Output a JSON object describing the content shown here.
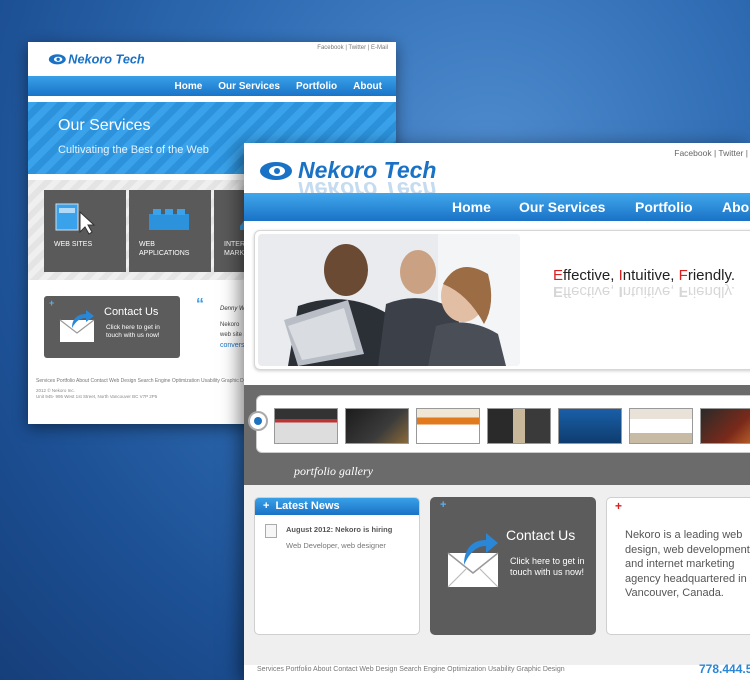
{
  "back_page": {
    "brand": "Nekoro Tech",
    "top_links": "Facebook | Twitter | E-Mail",
    "nav": [
      "Home",
      "Our Services",
      "Portfolio",
      "About"
    ],
    "hero": {
      "title": "Our Services",
      "subtitle": "Cultivating the Best of the Web"
    },
    "tiles": [
      {
        "label": "WEB SITES"
      },
      {
        "label": "WEB APPLICATIONS"
      },
      {
        "label": "INTER MARK"
      }
    ],
    "contact": {
      "title": "Contact Us",
      "text": "Click here to get in touch with us now!"
    },
    "quote": {
      "author": "Denny W",
      "text_1": "Nekoro",
      "text_2": "web site a",
      "link": "convers"
    },
    "footer_links": "Services Portfolio About Contact Web Design Search Engine Optimization Usability Graphic Design",
    "copyright_line1": "2012 © Nekoro Inc.",
    "copyright_line2": "Unit 945- 995 West 1st Street, North Vancouver BC V7P 2P5"
  },
  "front_page": {
    "brand": "Nekoro Tech",
    "top_links": "Facebook | Twitter | E",
    "nav": [
      "Home",
      "Our Services",
      "Portfolio",
      "Abo"
    ],
    "tagline": [
      {
        "initial": "E",
        "rest": "ffective, "
      },
      {
        "initial": "I",
        "rest": "ntuitive, "
      },
      {
        "initial": "F",
        "rest": "riendly."
      }
    ],
    "gallery_label": "portfolio gallery",
    "news": {
      "header": "Latest News",
      "item_title": "August 2012: Nekoro is hiring",
      "item_subtitle": "Web Developer, web designer"
    },
    "contact": {
      "title": "Contact Us",
      "text": "Click here to get in touch with us now!"
    },
    "about_text": "Nekoro is a leading web design, web development and internet marketing agency headquartered in Vancouver, Canada.",
    "footer_links": "Services Portfolio About Contact Web Design Search Engine Optimization Usability Graphic Design",
    "phone": "778.444.5"
  },
  "colors": {
    "brand_blue": "#1a72c6",
    "nav_light": "#41a7ec",
    "accent_red": "#d91f1f",
    "panel_gray": "#5c5c5c",
    "background_blue": "#2f6cb3"
  },
  "icons": {
    "logo": "eye-swoosh-logo",
    "contact": "envelope-arrow-icon",
    "news_item": "document-icon",
    "gallery_prev": "circle-arrow-left-icon"
  }
}
